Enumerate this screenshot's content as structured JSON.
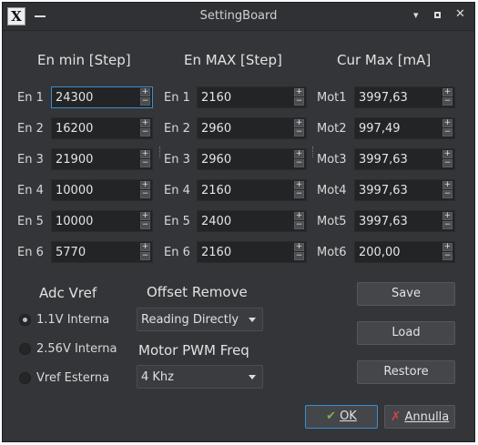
{
  "window": {
    "title": "SettingBoard"
  },
  "headers": {
    "en_min": "En min [Step]",
    "en_max": "En MAX [Step]",
    "cur_max": "Cur Max [mA]"
  },
  "rows": [
    {
      "label_min": "En 1",
      "min": "24300",
      "label_max": "En 1",
      "max": "2160",
      "label_mot": "Mot1",
      "cur": "3997,63"
    },
    {
      "label_min": "En 2",
      "min": "16200",
      "label_max": "En 2",
      "max": "2960",
      "label_mot": "Mot2",
      "cur": "997,49"
    },
    {
      "label_min": "En 3",
      "min": "21900",
      "label_max": "En 3",
      "max": "2960",
      "label_mot": "Mot3",
      "cur": "3997,63"
    },
    {
      "label_min": "En 4",
      "min": "10000",
      "label_max": "En 4",
      "max": "2160",
      "label_mot": "Mot4",
      "cur": "3997,63"
    },
    {
      "label_min": "En 5",
      "min": "10000",
      "label_max": "En 5",
      "max": "2400",
      "label_mot": "Mot5",
      "cur": "3997,63"
    },
    {
      "label_min": "En 6",
      "min": "5770",
      "label_max": "En 6",
      "max": "2160",
      "label_mot": "Mot6",
      "cur": "200,00"
    }
  ],
  "adc": {
    "title": "Adc Vref",
    "options": [
      "1.1V Interna",
      "2.56V Interna",
      "Vref Esterna"
    ],
    "selected": "1.1V Interna"
  },
  "offset": {
    "title": "Offset Remove",
    "value": "Reading Directly"
  },
  "pwm": {
    "title": "Motor PWM Freq",
    "value": "4 Khz"
  },
  "buttons": {
    "save": "Save",
    "load": "Load",
    "restore": "Restore",
    "ok": "OK",
    "cancel": "Annulla"
  },
  "icons": {
    "ok": "checkmark-icon",
    "cancel": "x-icon",
    "app": "x-window-icon"
  }
}
